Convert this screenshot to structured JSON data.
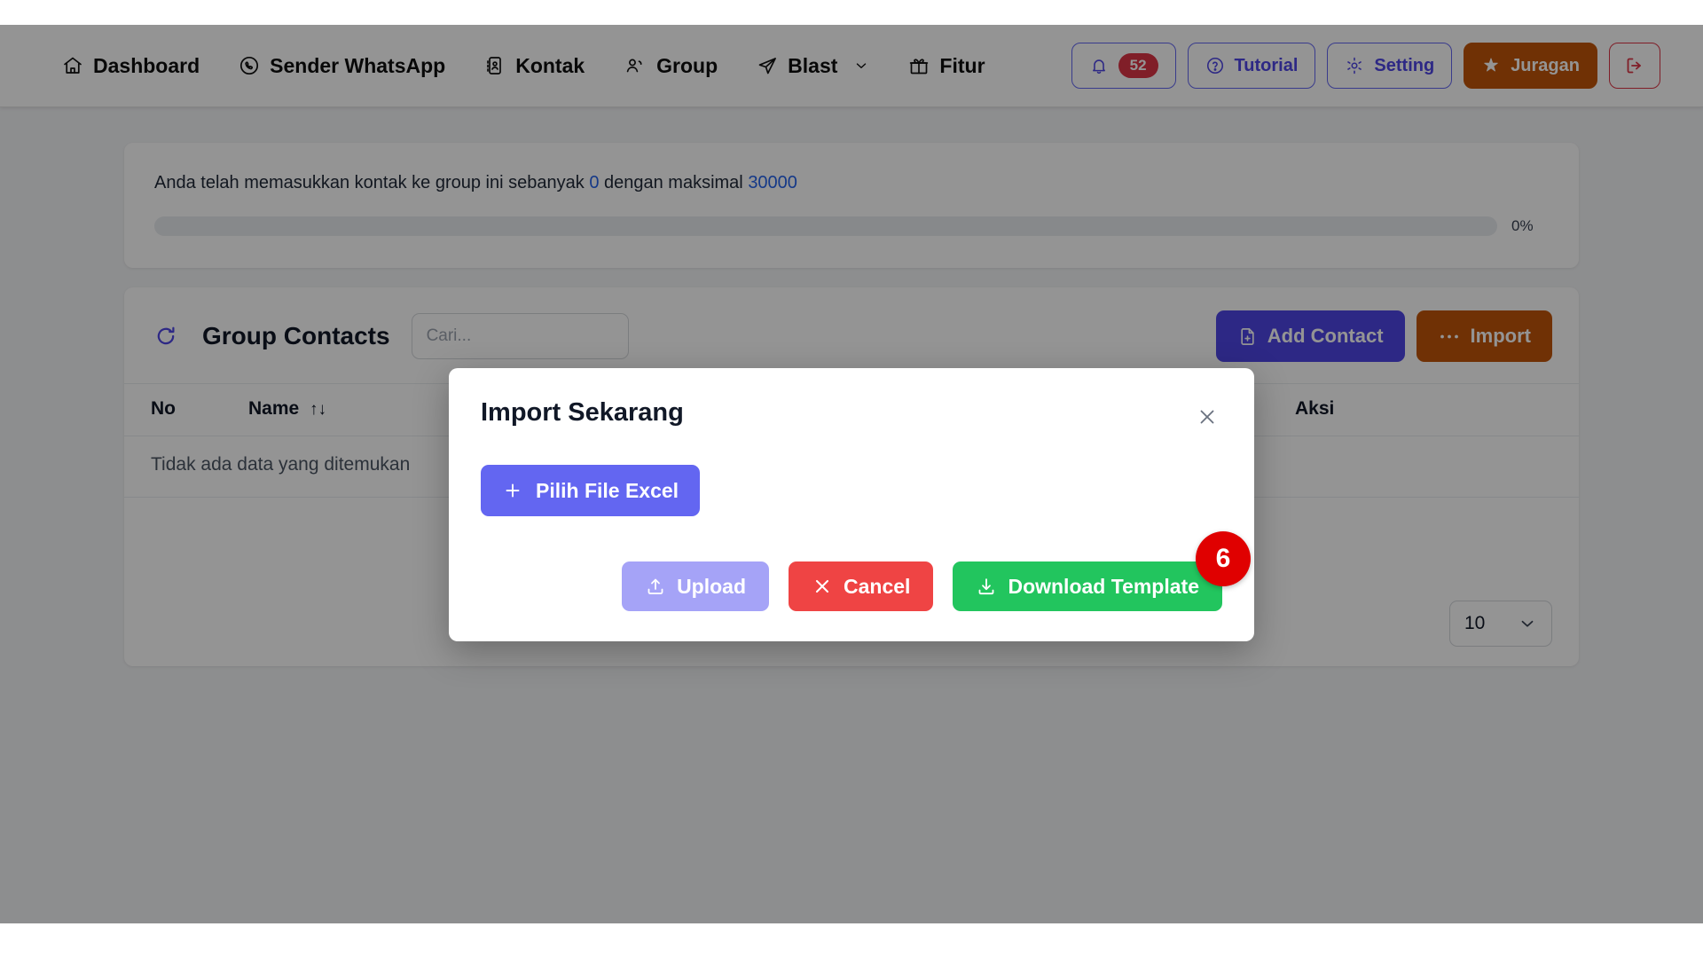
{
  "navbar": {
    "items": [
      {
        "label": "Dashboard",
        "icon": "home-icon",
        "caret": false
      },
      {
        "label": "Sender WhatsApp",
        "icon": "whatsapp-icon",
        "caret": false
      },
      {
        "label": "Kontak",
        "icon": "contact-card-icon",
        "caret": false
      },
      {
        "label": "Group",
        "icon": "users-icon",
        "caret": false
      },
      {
        "label": "Blast",
        "icon": "send-icon",
        "caret": true
      },
      {
        "label": "Fitur",
        "icon": "gift-icon",
        "caret": false
      }
    ],
    "notification": {
      "icon": "bell-icon",
      "count": "52"
    },
    "tutorial": {
      "label": "Tutorial",
      "icon": "help-circle-icon"
    },
    "setting": {
      "label": "Setting",
      "icon": "gear-icon"
    },
    "account": {
      "label": "Juragan",
      "icon": "star-icon"
    },
    "logout": {
      "icon": "logout-icon",
      "label": ""
    },
    "colors": {
      "indigo": "#4f46e5",
      "orange": "#c2550a",
      "red": "#dc3545"
    }
  },
  "quota": {
    "text_prefix": "Anda telah memasukkan kontak ke group ini sebanyak",
    "current": "0",
    "text_middle": "dengan maksimal",
    "maximum": "30000",
    "progress_percent": 0,
    "progress_label": "0%"
  },
  "contacts": {
    "title": "Group Contacts",
    "refresh_icon": "refresh-icon",
    "search": {
      "value": "",
      "placeholder": "Cari..."
    },
    "add_contact": {
      "label": "Add Contact",
      "icon": "file-plus-icon"
    },
    "import": {
      "label": "Import",
      "icon": "ellipsis-icon"
    },
    "table": {
      "columns": [
        "No",
        "Name",
        "Aksi"
      ],
      "sort_icon": "sort-arrows-icon",
      "empty_message": "Tidak ada data yang ditemukan",
      "rows": []
    },
    "page_size": {
      "value": "10",
      "icon": "chevron-down-icon"
    }
  },
  "modal": {
    "title": "Import Sekarang",
    "close_icon": "close-icon",
    "pick_file": {
      "label": "Pilih File Excel",
      "icon": "plus-icon"
    },
    "buttons": [
      {
        "label": "Upload",
        "icon": "upload-icon",
        "color": "#a5a3f7",
        "key": "upload"
      },
      {
        "label": "Cancel",
        "icon": "x-icon",
        "color": "#ef4444",
        "key": "cancel"
      },
      {
        "label": "Download Template",
        "icon": "download-icon",
        "color": "#22c55e",
        "key": "download"
      }
    ]
  },
  "step_marker": {
    "number": "6",
    "color": "#e00000"
  }
}
